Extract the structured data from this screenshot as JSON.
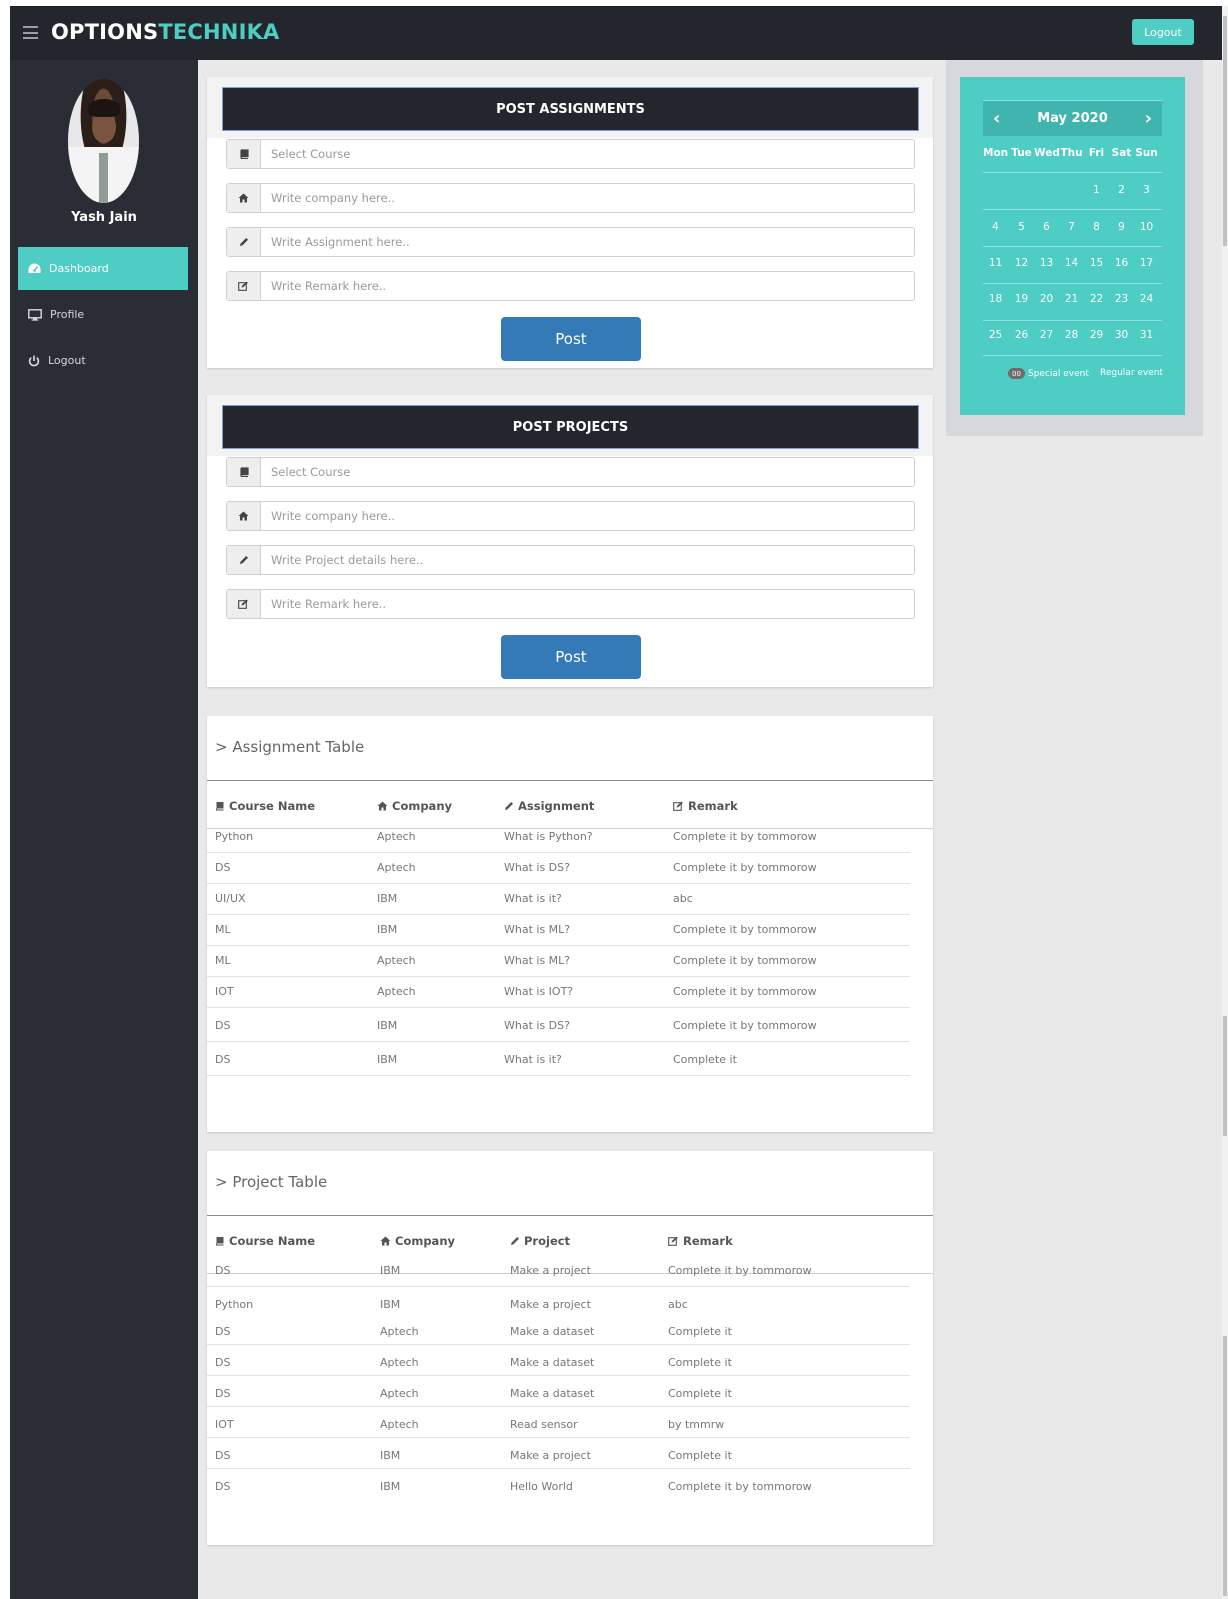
{
  "header": {
    "brand_part1": "OPTIONS",
    "brand_part2": "TECHNIKA",
    "logout_label": "Logout",
    "accent_color": "#4ecdc4",
    "bar_color": "#24262d"
  },
  "sidebar": {
    "user_name": "Yash Jain",
    "items": [
      {
        "label": "Dashboard",
        "icon": "dashboard-icon",
        "active": true
      },
      {
        "label": "Profile",
        "icon": "monitor-icon",
        "active": false
      },
      {
        "label": "Logout",
        "icon": "power-icon",
        "active": false
      }
    ]
  },
  "post_assignments": {
    "title": "POST ASSIGNMENTS",
    "fields": [
      {
        "icon": "book-icon",
        "placeholder": "Select Course"
      },
      {
        "icon": "home-icon",
        "placeholder": "Write company here.."
      },
      {
        "icon": "pencil-icon",
        "placeholder": "Write Assignment here.."
      },
      {
        "icon": "edit-icon",
        "placeholder": "Write Remark here.."
      }
    ],
    "button_label": "Post"
  },
  "post_projects": {
    "title": "POST PROJECTS",
    "fields": [
      {
        "icon": "book-icon",
        "placeholder": "Select Course"
      },
      {
        "icon": "home-icon",
        "placeholder": "Write company here.."
      },
      {
        "icon": "pencil-icon",
        "placeholder": "Write Project details here.."
      },
      {
        "icon": "edit-icon",
        "placeholder": "Write Remark here.."
      }
    ],
    "button_label": "Post"
  },
  "assignment_table": {
    "title": "> Assignment Table",
    "columns": [
      "Course Name",
      "Company",
      "Assignment",
      "Remark"
    ],
    "rows": [
      [
        "Python",
        "Aptech",
        "What is Python?",
        "Complete it by tommorow"
      ],
      [
        "DS",
        "Aptech",
        "What is DS?",
        "Complete it by tommorow"
      ],
      [
        "UI/UX",
        "IBM",
        "What is it?",
        "abc"
      ],
      [
        "ML",
        "IBM",
        "What is ML?",
        "Complete it by tommorow"
      ],
      [
        "ML",
        "Aptech",
        "What is ML?",
        "Complete it by tommorow"
      ],
      [
        "IOT",
        "Aptech",
        "What is IOT?",
        "Complete it by tommorow"
      ],
      [
        "DS",
        "IBM",
        "What is DS?",
        "Complete it by tommorow"
      ],
      [
        "DS",
        "IBM",
        "What is it?",
        "Complete it"
      ]
    ]
  },
  "project_table": {
    "title": "> Project Table",
    "columns": [
      "Course Name",
      "Company",
      "Project",
      "Remark"
    ],
    "rows": [
      [
        "DS",
        "IBM",
        "Make a project",
        "Complete it by tommorow"
      ],
      [
        "Python",
        "IBM",
        "Make a project",
        "abc"
      ],
      [
        "DS",
        "Aptech",
        "Make a dataset",
        "Complete it"
      ],
      [
        "DS",
        "Aptech",
        "Make a dataset",
        "Complete it"
      ],
      [
        "DS",
        "Aptech",
        "Make a dataset",
        "Complete it"
      ],
      [
        "IOT",
        "Aptech",
        "Read sensor",
        "by tmmrw"
      ],
      [
        "DS",
        "IBM",
        "Make a project",
        "Complete it"
      ],
      [
        "DS",
        "IBM",
        "Hello World",
        "Complete it by tommorow"
      ]
    ]
  },
  "calendar": {
    "month_label": "May 2020",
    "prev_symbol": "‹",
    "next_symbol": "›",
    "weekdays": [
      "Mon",
      "Tue",
      "Wed",
      "Thu",
      "Fri",
      "Sat",
      "Sun"
    ],
    "weeks": [
      [
        "",
        "",
        "",
        "",
        "1",
        "2",
        "3"
      ],
      [
        "4",
        "5",
        "6",
        "7",
        "8",
        "9",
        "10"
      ],
      [
        "11",
        "12",
        "13",
        "14",
        "15",
        "16",
        "17"
      ],
      [
        "18",
        "19",
        "20",
        "21",
        "22",
        "23",
        "24"
      ],
      [
        "25",
        "26",
        "27",
        "28",
        "29",
        "30",
        "31"
      ]
    ],
    "legend_badge": "00",
    "legend_special": "Special event",
    "legend_regular": "Regular event"
  }
}
